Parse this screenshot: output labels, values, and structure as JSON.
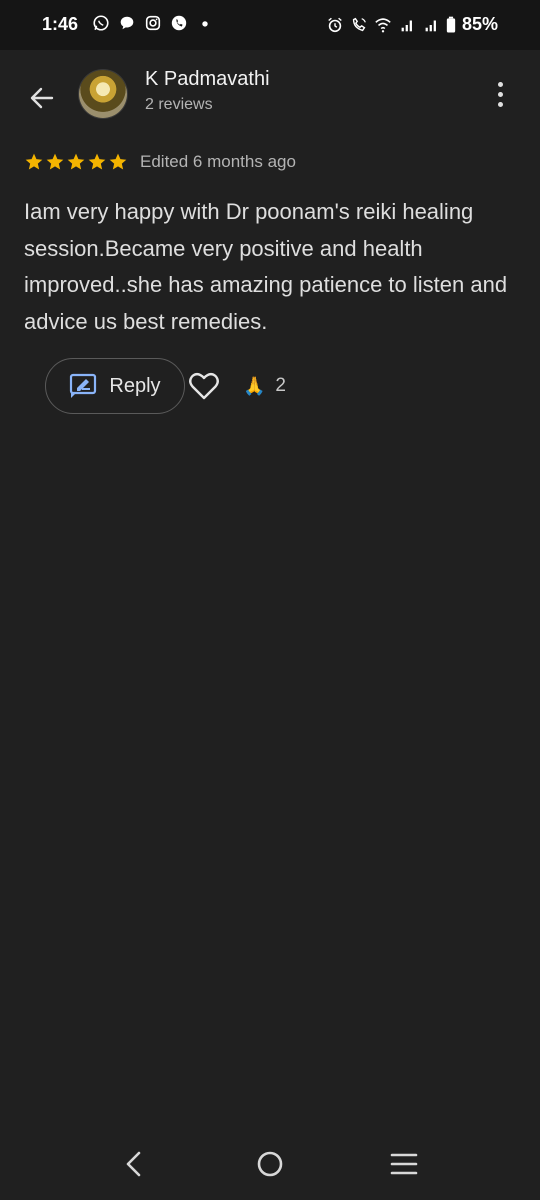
{
  "status_bar": {
    "time": "1:46",
    "battery": "85%"
  },
  "header": {
    "user_name": "K Padmavathi",
    "user_reviews": "2 reviews"
  },
  "review": {
    "rating": 5,
    "edited": "Edited 6 months ago",
    "text": "Iam very happy with Dr poonam's reiki healing session.Became very positive and health improved..she has amazing patience to listen and advice us best remedies."
  },
  "actions": {
    "reply_label": "Reply",
    "reaction_emoji": "🙏",
    "reaction_count": "2"
  },
  "colors": {
    "background": "#202020",
    "statusbar": "#151515",
    "star": "#f4b400",
    "reply_icon": "#8ab4f8"
  },
  "icons": [
    "whatsapp-icon",
    "chat-bubble-icon",
    "instagram-icon",
    "viber-icon",
    "alarm-icon",
    "wifi-call-icon",
    "wifi-icon",
    "signal-icon",
    "battery-icon",
    "back-arrow-icon",
    "more-vert-icon",
    "star-icon",
    "reply-icon",
    "heart-icon",
    "nav-back-icon",
    "nav-home-icon",
    "nav-recents-icon"
  ]
}
